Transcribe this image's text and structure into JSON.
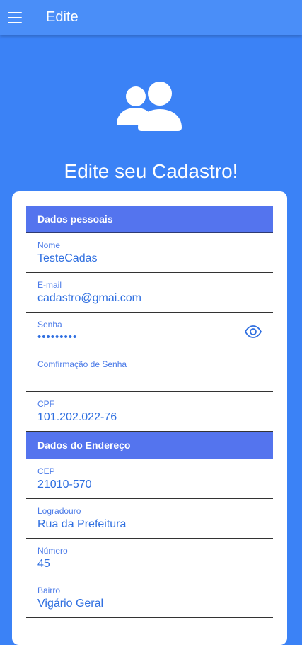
{
  "appbar": {
    "title": "Edite",
    "menu_icon": "menu-icon"
  },
  "hero": {
    "icon": "users-icon",
    "title": "Edite seu Cadastro!"
  },
  "sections": {
    "personal": {
      "title": "Dados pessoais",
      "fields": {
        "nome": {
          "label": "Nome",
          "value": "TesteCadas"
        },
        "email": {
          "label": "E-mail",
          "value": "cadastro@gmai.com"
        },
        "senha": {
          "label": "Senha",
          "value": "•••••••••",
          "icon": "eye-icon"
        },
        "confirmacao": {
          "label": "Comfirmação de Senha",
          "value": ""
        },
        "cpf": {
          "label": "CPF",
          "value": "101.202.022-76"
        }
      }
    },
    "address": {
      "title": "Dados do Endereço",
      "fields": {
        "cep": {
          "label": "CEP",
          "value": "21010-570"
        },
        "logradouro": {
          "label": "Logradouro",
          "value": "Rua da Prefeitura"
        },
        "numero": {
          "label": "Número",
          "value": "45"
        },
        "bairro": {
          "label": "Bairro",
          "value": "Vigário Geral"
        }
      }
    }
  },
  "colors": {
    "background": "#3b82f6",
    "appbar": "#4a8ef8",
    "section_header": "#5474ee",
    "label": "#4a7ae8",
    "value": "#2f6fe0"
  }
}
